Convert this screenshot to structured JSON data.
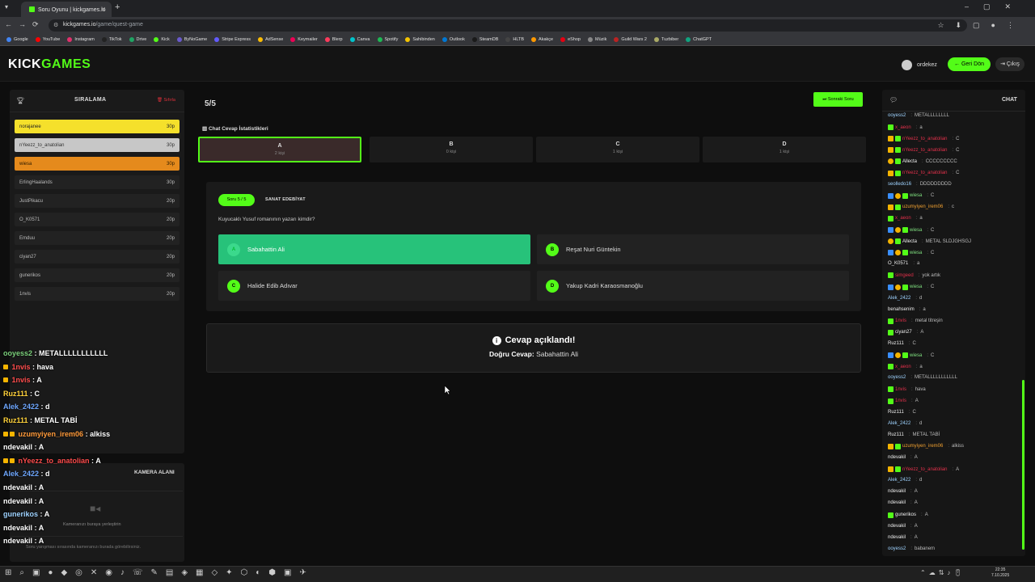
{
  "browser": {
    "tab_title": "Soru Oyunu | kickgames.io",
    "url_host": "kickgames.io",
    "url_path": "/game/quest-game",
    "bookmarks": [
      "Google",
      "YouTube",
      "Instagram",
      "TikTok",
      "Drive",
      "Kick",
      "ByNoGame",
      "Stripe Express",
      "AdSense",
      "Keymailer",
      "Blerp",
      "Canva",
      "Spotify",
      "Sahibinden",
      "Outlook",
      "SteamDB",
      "HLTB",
      "Akakçe",
      "eShop",
      "Müzik",
      "Guild Wars 2",
      "Tuzbiber",
      "ChatGPT"
    ]
  },
  "header": {
    "logo_main": "KICK",
    "logo_accent": "GAMES",
    "username": "ordekez",
    "back_label": "Geri Dön",
    "exit_label": "Çıkış"
  },
  "leaderboard": {
    "title": "SIRALAMA",
    "reset_label": "Sıfırla",
    "rows": [
      {
        "name": "norajanee",
        "score": "30p"
      },
      {
        "name": "nYeezz_to_anatolian",
        "score": "30p"
      },
      {
        "name": "wiesa",
        "score": "30p"
      },
      {
        "name": "ErlingHaalands",
        "score": "30p"
      },
      {
        "name": "JustPikacu",
        "score": "20p"
      },
      {
        "name": "O_K0571",
        "score": "20p"
      },
      {
        "name": "Emduu",
        "score": "20p"
      },
      {
        "name": "ciyan27",
        "score": "20p"
      },
      {
        "name": "gunerikos",
        "score": "20p"
      },
      {
        "name": "1nvis",
        "score": "20p"
      }
    ]
  },
  "overlay_chat": [
    {
      "user": "ooyess2",
      "msg": "METALLLLLLLLLLL"
    },
    {
      "user": "1nvis",
      "msg": "hava"
    },
    {
      "user": "1nvis",
      "msg": "A"
    },
    {
      "user": "Ruz111",
      "msg": "C"
    },
    {
      "user": "Alek_2422",
      "msg": "d"
    },
    {
      "user": "Ruz111",
      "msg": "METAL TABİ"
    },
    {
      "user": "uzumyiyen_irem06",
      "msg": "alkiss"
    },
    {
      "user": "ndevakil",
      "msg": "A"
    },
    {
      "user": "nYeezz_to_anatolian",
      "msg": "A"
    },
    {
      "user": "Alek_2422",
      "msg": "d"
    },
    {
      "user": "ndevakil",
      "msg": "A"
    },
    {
      "user": "ndevakil",
      "msg": "A"
    },
    {
      "user": "gunerikos",
      "msg": "A"
    },
    {
      "user": "ndevakil",
      "msg": "A"
    },
    {
      "user": "ndevakil",
      "msg": "A"
    }
  ],
  "camera": {
    "title": "KAMERA ALANI",
    "placeholder": "Kameranızı buraya yerleştirin",
    "footer": "Soru yarışması sırasında kameranızı burada görebilirsiniz."
  },
  "game": {
    "counter": "5/5",
    "next_label": "Sonraki Soru",
    "stats_title": "Chat Cevap İstatistikleri",
    "stats": [
      {
        "letter": "A",
        "count": "2 kişi"
      },
      {
        "letter": "B",
        "count": "0 kişi"
      },
      {
        "letter": "C",
        "count": "1 kişi"
      },
      {
        "letter": "D",
        "count": "1 kişi"
      }
    ],
    "question_pill": "Soru 5 / 5",
    "category": "SANAT EDEBİYAT",
    "question": "Kuyucaklı Yusuf romanının yazarı kimdir?",
    "answers": [
      {
        "letter": "A",
        "text": "Sabahattin Ali"
      },
      {
        "letter": "B",
        "text": "Reşat Nuri Güntekin"
      },
      {
        "letter": "C",
        "text": "Halide Edib Adıvar"
      },
      {
        "letter": "D",
        "text": "Yakup Kadri Karaosmanoğlu"
      }
    ],
    "reveal_title": "Cevap açıklandı!",
    "reveal_prefix": "Doğru Cevap:",
    "reveal_answer": "Sabahattin Ali"
  },
  "chat": {
    "title": "CHAT",
    "messages": [
      {
        "user": "ooyess2",
        "msg": "METALLLLLLLL"
      },
      {
        "user": "x_aeon",
        "msg": "a"
      },
      {
        "user": "nYeezz_to_anatolian",
        "msg": "C"
      },
      {
        "user": "nYeezz_to_anatolian",
        "msg": "C"
      },
      {
        "user": "Allecta",
        "msg": "CCCCCCCCC"
      },
      {
        "user": "nYeezz_to_anatolian",
        "msg": "C"
      },
      {
        "user": "seolledo16",
        "msg": "DDDDDDDDD"
      },
      {
        "user": "wiesa",
        "msg": "C"
      },
      {
        "user": "uzumyiyen_irem06",
        "msg": "c"
      },
      {
        "user": "x_aeon",
        "msg": "a"
      },
      {
        "user": "wiesa",
        "msg": "C"
      },
      {
        "user": "Allecta",
        "msg": "METAL SLDJGHSGJ"
      },
      {
        "user": "wiesa",
        "msg": "C"
      },
      {
        "user": "O_K0571",
        "msg": "a"
      },
      {
        "user": "simgeed",
        "msg": "yok artık"
      },
      {
        "user": "wiesa",
        "msg": "C"
      },
      {
        "user": "Alek_2422",
        "msg": "d"
      },
      {
        "user": "benahsenim",
        "msg": "a"
      },
      {
        "user": "1nvis",
        "msg": "metal titreşin"
      },
      {
        "user": "ciyan27",
        "msg": "A"
      },
      {
        "user": "Ruz111",
        "msg": "C"
      },
      {
        "user": "wiesa",
        "msg": "C"
      },
      {
        "user": "x_aeon",
        "msg": "a"
      },
      {
        "user": "ooyess2",
        "msg": "METALLLLLLLLLLL"
      },
      {
        "user": "1nvis",
        "msg": "hava"
      },
      {
        "user": "1nvis",
        "msg": "A"
      },
      {
        "user": "Ruz111",
        "msg": "C"
      },
      {
        "user": "Alek_2422",
        "msg": "d"
      },
      {
        "user": "Ruz111",
        "msg": "METAL TABİ"
      },
      {
        "user": "uzumyiyen_irem06",
        "msg": "alkiss"
      },
      {
        "user": "ndevakil",
        "msg": "A"
      },
      {
        "user": "nYeezz_to_anatolian",
        "msg": "A"
      },
      {
        "user": "Alek_2422",
        "msg": "d"
      },
      {
        "user": "ndevakil",
        "msg": "A"
      },
      {
        "user": "ndevakil",
        "msg": "A"
      },
      {
        "user": "gunerikos",
        "msg": "A"
      },
      {
        "user": "ndevakil",
        "msg": "A"
      },
      {
        "user": "ndevakil",
        "msg": "A"
      },
      {
        "user": "ooyess2",
        "msg": "babanem"
      }
    ]
  },
  "taskbar": {
    "time": "22:35",
    "date": "7.10.2025"
  },
  "colors": {
    "accent": "#53fc18",
    "correct": "#27c27a",
    "gold": "#f5e02b",
    "silver": "#c7c7c7",
    "bronze": "#e58a1c"
  }
}
